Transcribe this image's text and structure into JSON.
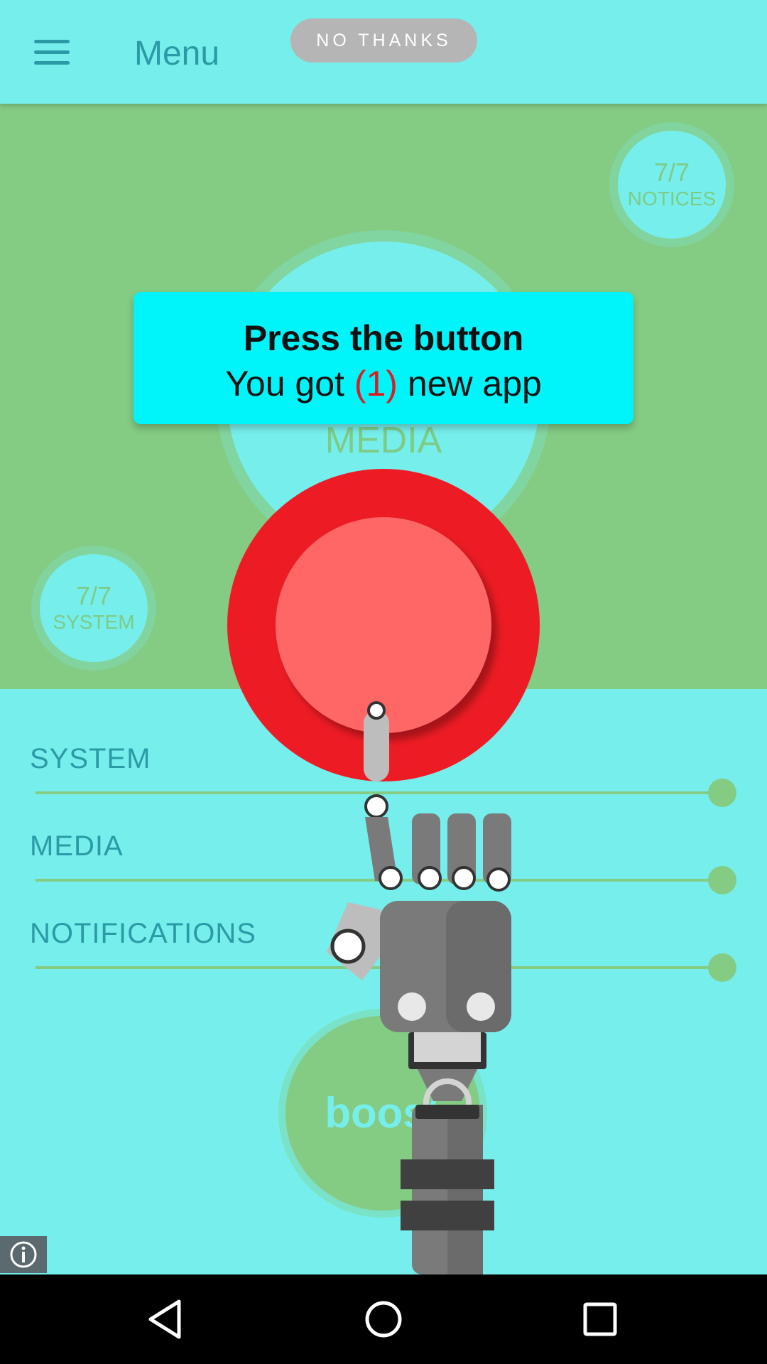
{
  "header": {
    "menu_label": "Menu",
    "no_thanks_label": "NO THANKS"
  },
  "stats": {
    "notices": {
      "value": "7/7",
      "label": "NOTICES"
    },
    "system": {
      "value": "7/7",
      "label": "SYSTEM"
    }
  },
  "media_circle_label": "MEDIA",
  "popup": {
    "title": "Press the button",
    "subtitle_prefix": "You got ",
    "count": "(1)",
    "subtitle_suffix": " new app"
  },
  "sliders": [
    {
      "label": "SYSTEM",
      "level": 1.0
    },
    {
      "label": "MEDIA",
      "level": 1.0
    },
    {
      "label": "NOTIFICATIONS",
      "level": 1.0
    }
  ],
  "boost_label": "boost",
  "colors": {
    "background": "#76efec",
    "panel_green": "#84cb83",
    "accent_teal": "#2b9aa6",
    "button_red": "#ed1c24",
    "button_inner": "#ff6666",
    "popup_bg": "#00f5fa",
    "count_red": "#d81f26"
  },
  "icons": {
    "menu": "hamburger-icon",
    "info": "info-icon",
    "back": "back-triangle-icon",
    "home": "home-circle-icon",
    "recents": "recents-square-icon"
  }
}
